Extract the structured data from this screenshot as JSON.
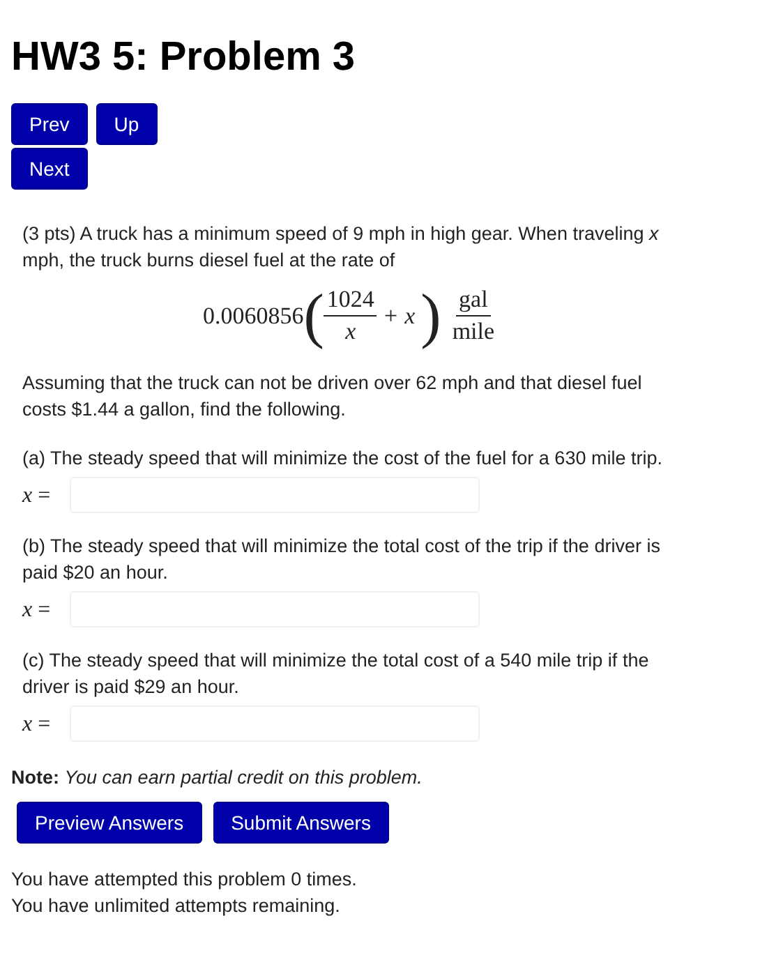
{
  "title": "HW3 5: Problem 3",
  "nav_buttons": [
    "Prev",
    "Up",
    "Next"
  ],
  "intro": "(3 pts) A truck has a minimum speed of 9 mph in high gear. When traveling *x* mph, the truck burns diesel fuel at the rate of",
  "formula": {
    "coefficient": "0.0060856",
    "open_paren": "(",
    "numerator": "1024",
    "denominator": "x",
    "plus_term": "+ x",
    "close_paren": ")",
    "unit_numerator": "gal",
    "unit_denominator": "mile"
  },
  "assumption": "Assuming that the truck can not be driven over 62 mph and that diesel fuel costs $1.44 a gallon, find the following.",
  "parts": [
    {
      "question": "(a) The steady speed that will minimize the cost of the fuel for a 630 mile trip.",
      "answer_label": "*x* ="
    },
    {
      "question": "(b) The steady speed that will minimize the total cost of the trip if the driver is paid $20 an hour.",
      "answer_label": "*x* ="
    },
    {
      "question": "(c) The steady speed that will minimize the total cost of a 540 mile trip if the driver is paid $29 an hour.",
      "answer_label": "*x* ="
    }
  ],
  "note": "**Note:** *You can earn partial credit on this problem.*",
  "action_buttons": [
    "Preview Answers",
    "Submit Answers"
  ],
  "attempts": [
    "You have attempted this problem 0 times.",
    "You have unlimited attempts remaining."
  ]
}
